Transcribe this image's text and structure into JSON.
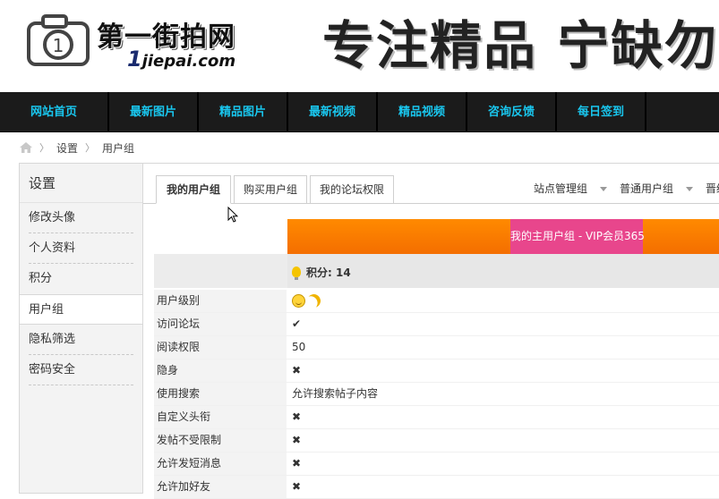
{
  "header": {
    "logo_cn": "第一街拍网",
    "logo_url_num": "1",
    "logo_url_text": "jiepai.com",
    "slogan": "专注精品 宁缺勿"
  },
  "nav": {
    "items": [
      "网站首页",
      "最新图片",
      "精品图片",
      "最新视频",
      "精品视频",
      "咨询反馈",
      "每日签到"
    ]
  },
  "breadcrumb": {
    "items": [
      "设置",
      "用户组"
    ]
  },
  "sidebar": {
    "title": "设置",
    "items": [
      "修改头像",
      "个人资料",
      "积分",
      "用户组",
      "隐私筛选",
      "密码安全"
    ],
    "active_index": 3
  },
  "tabs": {
    "items": [
      "我的用户组",
      "购买用户组",
      "我的论坛权限"
    ],
    "active_index": 0
  },
  "menus": {
    "items": [
      "站点管理组",
      "普通用户组",
      "晋级"
    ]
  },
  "group": {
    "main_group_label": "我的主用户组 - VIP会员365",
    "score_label": "积分: 14"
  },
  "permissions": [
    {
      "label": "用户级别",
      "value_type": "emoji",
      "value": ""
    },
    {
      "label": "访问论坛",
      "value_type": "yes",
      "value": "✔"
    },
    {
      "label": "阅读权限",
      "value_type": "text",
      "value": "50"
    },
    {
      "label": "隐身",
      "value_type": "no",
      "value": "✖"
    },
    {
      "label": "使用搜索",
      "value_type": "text",
      "value": "允许搜索帖子内容"
    },
    {
      "label": "自定义头衔",
      "value_type": "no",
      "value": "✖"
    },
    {
      "label": "发帖不受限制",
      "value_type": "no",
      "value": "✖"
    },
    {
      "label": "允许发短消息",
      "value_type": "no",
      "value": "✖"
    },
    {
      "label": "允许加好友",
      "value_type": "no",
      "value": "✖"
    }
  ],
  "colors": {
    "nav_bg": "#1b1b1b",
    "nav_text": "#19c6ee",
    "orange_bar": "#f47a00",
    "vip_badge": "#e8468c",
    "yes": "#4caf3a",
    "no": "#e0432b"
  }
}
